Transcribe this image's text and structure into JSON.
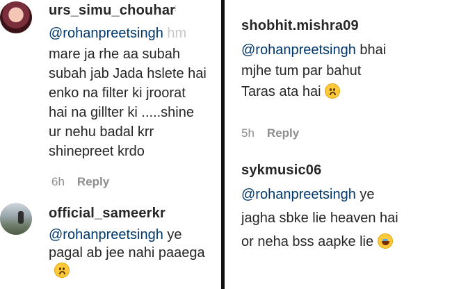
{
  "left": {
    "comment1": {
      "username": "urs_simu_chouhar",
      "mention": "@rohanpreetsingh",
      "mention_suffix": "hm",
      "lines": [
        "mare ja rhe aa subah",
        "subah jab Jada hslete hai",
        "enko na filter ki jroorat",
        "hai na gillter ki .....shine",
        "ur nehu badal krr",
        "shinepreet krdo"
      ],
      "time": "6h",
      "reply": "Reply"
    },
    "comment2": {
      "username": "official_sameerkr",
      "mention": "@rohanpreetsingh",
      "line1_suffix": "ye",
      "line2": "pagal ab jee nahi paaega",
      "emoji": "sad-face-emoji"
    }
  },
  "right": {
    "comment1": {
      "username": "shobhit.mishra09",
      "mention": "@rohanpreetsingh",
      "mention_suffix": "bhai",
      "line2": "mjhe tum par bahut",
      "line3": "Taras ata hai",
      "emoji": "sad-face-emoji",
      "time": "5h",
      "reply": "Reply"
    },
    "comment2": {
      "username": "sykmusic06",
      "mention": "@rohanpreetsingh",
      "mention_suffix": "ye",
      "line2": "jagha sbke lie heaven hai",
      "line3": "or neha bss aapke lie",
      "emoji": "laughing-tears-emoji"
    }
  },
  "colors": {
    "mention": "#00376b",
    "text": "#262626",
    "meta": "#8e8e8e",
    "divider": "#111111"
  }
}
